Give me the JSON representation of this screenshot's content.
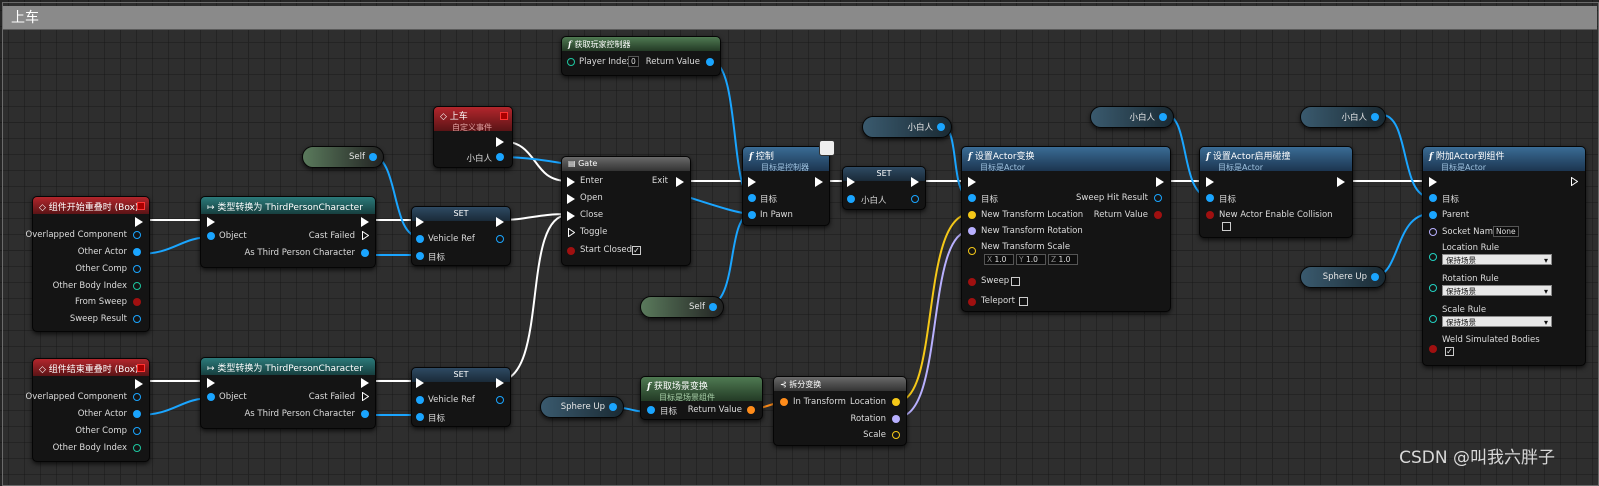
{
  "comment": {
    "title": "上车"
  },
  "nodes": {
    "begin_overlap": {
      "title": "组件开始重叠时 (Box)",
      "pins": [
        "Overlapped Component",
        "Other Actor",
        "Other Comp",
        "Other Body Index",
        "From Sweep",
        "Sweep Result"
      ]
    },
    "end_overlap": {
      "title": "组件结束重叠时 (Box)",
      "pins": [
        "Overlapped Component",
        "Other Actor",
        "Other Comp",
        "Other Body Index"
      ]
    },
    "cast1": {
      "title": "类型转换为 ThirdPersonCharacter",
      "object": "Object",
      "cast_failed": "Cast Failed",
      "as_third": "As Third Person Character"
    },
    "cast2": {
      "title": "类型转换为 ThirdPersonCharacter",
      "object": "Object",
      "cast_failed": "Cast Failed",
      "as_third": "As Third Person Character"
    },
    "set1": {
      "title": "SET",
      "vehicle_ref": "Vehicle Ref",
      "target": "目标"
    },
    "set2": {
      "title": "SET",
      "vehicle_ref": "Vehicle Ref",
      "target": "目标"
    },
    "custom_event": {
      "title": "上车",
      "subtitle": "自定义事件",
      "pin": "小白人"
    },
    "gate": {
      "title": "Gate",
      "enter": "Enter",
      "open": "Open",
      "close": "Close",
      "toggle": "Toggle",
      "start_closed": "Start Closed",
      "exit": "Exit",
      "start_closed_checked": true
    },
    "get_player_controller": {
      "title": "获取玩家控制器",
      "player_index_label": "Player Index",
      "player_index_value": "0",
      "return_value": "Return Value"
    },
    "possess": {
      "title": "控制",
      "subtitle": "目标是控制器",
      "target": "目标",
      "in_pawn": "In Pawn"
    },
    "set3": {
      "title": "SET",
      "pin": "小白人"
    },
    "set_actor_transform": {
      "title": "设置Actor变换",
      "subtitle": "目标是Actor",
      "target": "目标",
      "sweep_hit": "Sweep Hit Result",
      "new_loc": "New Transform Location",
      "return_value": "Return Value",
      "new_rot": "New Transform Rotation",
      "new_scale": "New Transform Scale",
      "scale_x_label": "X",
      "scale_x": "1.0",
      "scale_y_label": "Y",
      "scale_y": "1.0",
      "scale_z_label": "Z",
      "scale_z": "1.0",
      "sweep": "Sweep",
      "teleport": "Teleport"
    },
    "set_collision": {
      "title": "设置Actor启用碰撞",
      "subtitle": "目标是Actor",
      "target": "目标",
      "new_enable": "New Actor Enable Collision"
    },
    "attach": {
      "title": "附加Actor到组件",
      "subtitle": "目标是Actor",
      "target": "目标",
      "parent": "Parent",
      "socket_name": "Socket Name",
      "socket_value": "None",
      "location_rule": "Location Rule",
      "location_value": "保持场景",
      "rotation_rule": "Rotation Rule",
      "rotation_value": "保持场景",
      "scale_rule": "Scale Rule",
      "scale_value": "保持场景",
      "weld": "Weld Simulated Bodies",
      "weld_checked": true
    },
    "get_world_transform": {
      "title": "获取场景变换",
      "subtitle": "目标是场景组件",
      "target": "目标",
      "return_value": "Return Value"
    },
    "break_transform": {
      "title": "拆分变换",
      "in_transform": "In Transform",
      "location": "Location",
      "rotation": "Rotation",
      "scale": "Scale"
    }
  },
  "variables": {
    "self1": "Self",
    "self2": "Self",
    "xiaobairen1": "小白人",
    "xiaobairen2": "小白人",
    "xiaobairen3": "小白人",
    "sphere_up1": "Sphere Up",
    "sphere_up2": "Sphere Up"
  },
  "watermark": "CSDN @叫我六胖子",
  "colors": {
    "exec": "#ffffff",
    "object_pin": "#1aa5ff",
    "transform_pin": "#ff8c1a",
    "vector_pin": "#f5c818",
    "rotator_pin": "#b8b0ff",
    "event_header": "#b3262c",
    "function_header": "#3a6c95",
    "pure_header": "#4f7a52"
  }
}
